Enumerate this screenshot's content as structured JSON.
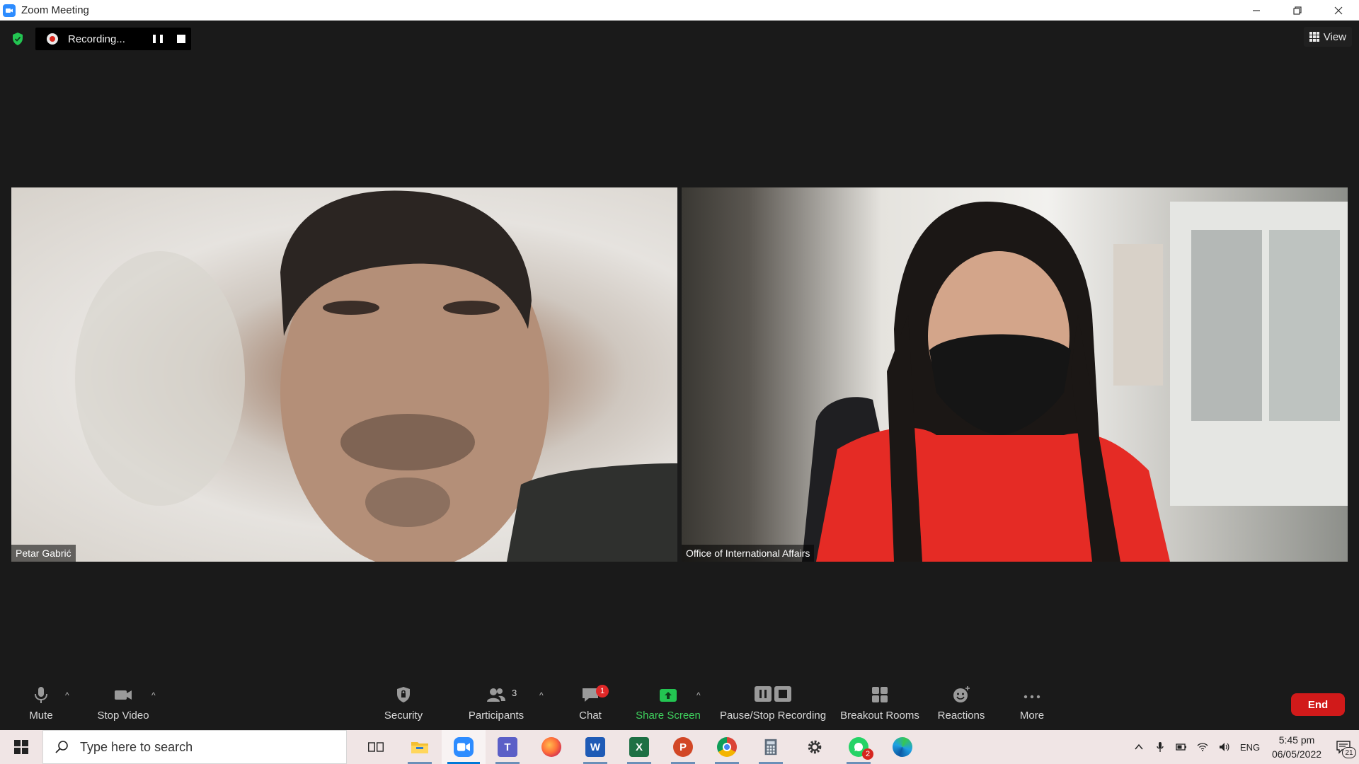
{
  "window": {
    "title": "Zoom Meeting",
    "icon": "zoom-app-icon",
    "controls": [
      "minimize",
      "restore",
      "close"
    ]
  },
  "meeting": {
    "recording_text": "Recording...",
    "view_label": "View",
    "participants": [
      {
        "name": "Petar Gabrić"
      },
      {
        "name": "Office of International Affairs"
      }
    ]
  },
  "toolbar": {
    "mute": "Mute",
    "stop_video": "Stop Video",
    "security": "Security",
    "participants": "Participants",
    "participants_count": "3",
    "chat": "Chat",
    "chat_badge": "1",
    "share_screen": "Share Screen",
    "pause_stop_recording": "Pause/Stop Recording",
    "breakout_rooms": "Breakout Rooms",
    "reactions": "Reactions",
    "more": "More",
    "end": "End",
    "share_color": "#3fd25e",
    "end_color": "#d11a1a"
  },
  "taskbar": {
    "search_placeholder": "Type here to search",
    "apps": [
      "task-view",
      "file-explorer",
      "zoom",
      "teams",
      "firefox",
      "word",
      "excel",
      "powerpoint",
      "chrome",
      "calculator",
      "settings",
      "whatsapp",
      "edge"
    ],
    "whatsapp_badge": "2",
    "language": "ENG",
    "time": "5:45 pm",
    "date": "06/05/2022",
    "notifications_count": "21"
  }
}
